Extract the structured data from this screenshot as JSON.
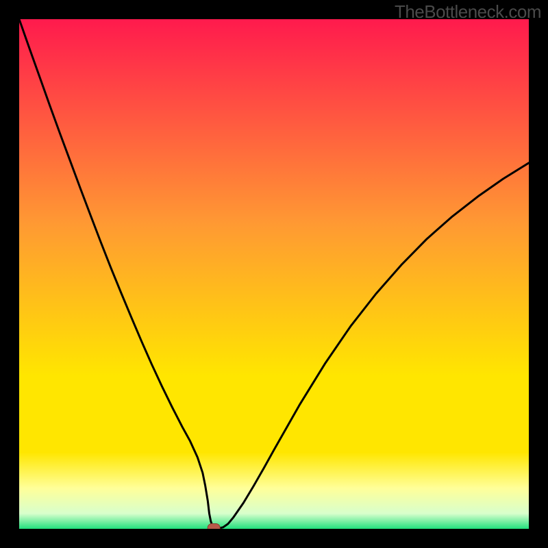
{
  "watermark": "TheBottleneck.com",
  "colors": {
    "frame": "#000000",
    "grad_top": "#ff1a4d",
    "grad_mid1": "#ff9933",
    "grad_mid2": "#ffe600",
    "grad_mid3": "#ffff99",
    "grad_bot": "#22e07d",
    "curve": "#000000",
    "marker_fill": "#b85a4a",
    "marker_stroke": "#8a3f32"
  },
  "chart_data": {
    "type": "line",
    "title": "",
    "xlabel": "",
    "ylabel": "",
    "xlim": [
      0,
      100
    ],
    "ylim": [
      0,
      100
    ],
    "x": [
      0,
      2,
      4,
      6,
      8,
      10,
      12,
      14,
      16,
      18,
      20,
      22,
      24,
      26,
      28,
      30,
      32,
      33.5,
      35,
      36,
      36.5,
      37,
      37.3,
      37.6,
      38,
      38.5,
      39,
      40,
      41,
      42,
      44,
      46,
      48,
      50,
      55,
      60,
      65,
      70,
      75,
      80,
      85,
      90,
      95,
      100
    ],
    "y": [
      100,
      94.3,
      88.7,
      83.1,
      77.6,
      72.2,
      66.8,
      61.5,
      56.3,
      51.2,
      46.3,
      41.5,
      36.8,
      32.3,
      28.0,
      23.9,
      20.0,
      17.3,
      14.0,
      11.0,
      8.5,
      5.5,
      3.0,
      1.5,
      0.3,
      0.1,
      0.1,
      0.3,
      1.0,
      2.2,
      5.1,
      8.4,
      11.9,
      15.5,
      24.3,
      32.4,
      39.7,
      46.1,
      51.8,
      56.9,
      61.3,
      65.2,
      68.7,
      71.8
    ],
    "marker": {
      "x": 38.2,
      "y": 0.2
    }
  }
}
